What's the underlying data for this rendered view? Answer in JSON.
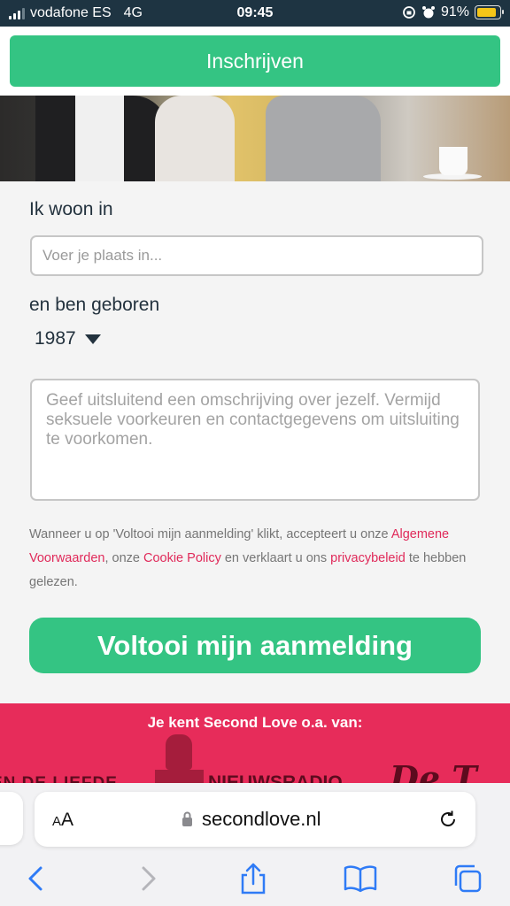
{
  "status_bar": {
    "carrier": "vodafone ES",
    "network": "4G",
    "time": "09:45",
    "battery": "91%",
    "battery_level": 0.91
  },
  "signup_button": {
    "label": "Inschrijven"
  },
  "form": {
    "city_label": "Ik woon in",
    "city_placeholder": "Voer je plaats in...",
    "birth_label": "en ben geboren",
    "birth_year": "1987",
    "description_placeholder": "Geef uitsluitend een omschrijving over jezelf. Vermijd seksuele voorkeuren en contactgegevens om uitsluiting te voorkomen.",
    "terms": {
      "part1": "Wanneer u op 'Voltooi mijn aanmelding' klikt, accepteert u onze ",
      "link_terms": "Algemene Voorwaarden",
      "part2": ", onze ",
      "link_cookie": "Cookie Policy",
      "part3": " en verklaart u ons ",
      "link_privacy": "privacybeleid",
      "part4": " te hebben gelezen."
    },
    "submit_label": "Voltooi mijn aanmelding"
  },
  "press": {
    "title": "Je kent Second Love o.a. van:",
    "logos": [
      "EN DE LIEFDE",
      "NIEUWSRADIO",
      "De T"
    ]
  },
  "browser": {
    "text_size_small": "A",
    "text_size_large": "A",
    "url": "secondlove.nl"
  },
  "colors": {
    "accent_green": "#34c483",
    "brand_pink": "#e72c5a",
    "link_pink": "#e02a5a",
    "status_bar": "#1e3442"
  }
}
